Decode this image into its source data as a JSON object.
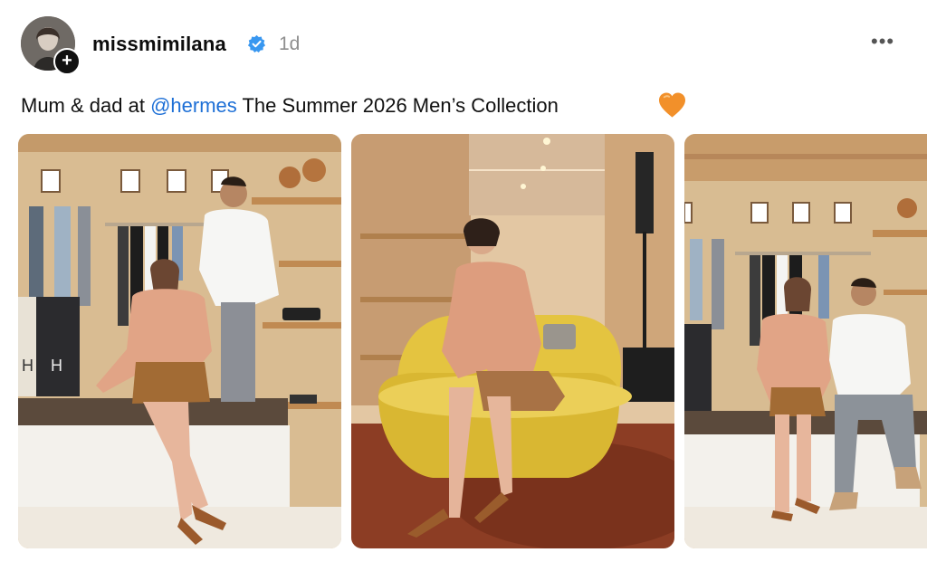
{
  "post": {
    "username": "missmimilana",
    "timestamp": "1d",
    "more_label": "•••",
    "add_label": "+",
    "caption_before": "Mum & dad at ",
    "caption_mention": "@hermes",
    "caption_after": " The Summer 2026 Men’s Collection",
    "caption_emoji": "orange-heart-icon"
  },
  "media": {
    "photos": [
      {
        "label": "couple-in-boutique-seated-photo"
      },
      {
        "label": "woman-on-yellow-armchair-photo"
      },
      {
        "label": "couple-seated-together-photo"
      }
    ]
  },
  "colors": {
    "verified": "#3897f0",
    "mention": "#1d6fd6",
    "heart": "#f2902a",
    "timestamp": "#8e8e8e"
  }
}
